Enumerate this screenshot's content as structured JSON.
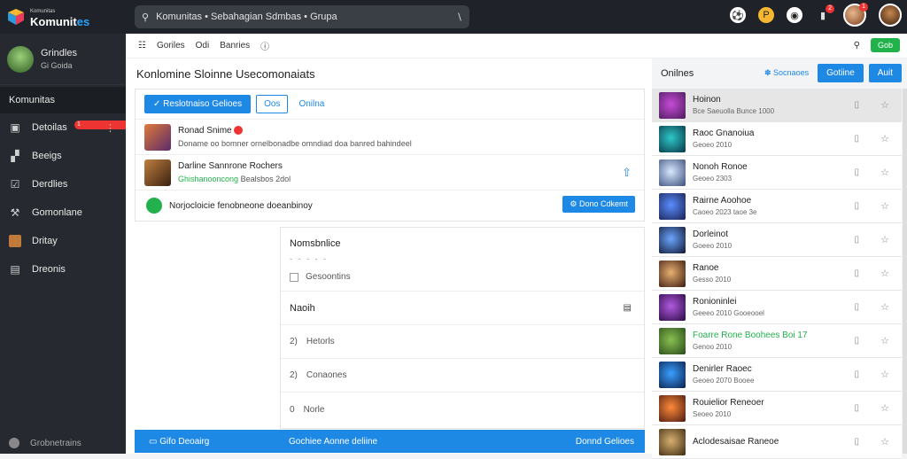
{
  "app": {
    "title": "Komunit",
    "title_accent": "es",
    "subtitle": "Komunitas"
  },
  "search": {
    "text": "Komunitas • Sebahagian Sdmbas • Grupa"
  },
  "top": {
    "notif_count": "2",
    "avatar_badge": "1"
  },
  "profile": {
    "name": "Grindles",
    "sub": "Gi Goida"
  },
  "sidebar": {
    "title": "Komunitas",
    "items": [
      {
        "label": "Detoilas",
        "icon": "camera-icon",
        "badge": "1"
      },
      {
        "label": "Beeigs",
        "icon": "layout-icon"
      },
      {
        "label": "Derdlies",
        "icon": "check-icon"
      },
      {
        "label": "Gomonlane",
        "icon": "hammer-icon"
      },
      {
        "label": "Dritay",
        "icon": "character-icon"
      },
      {
        "label": "Dreonis",
        "icon": "document-icon"
      }
    ],
    "footer": "Grobnetrains"
  },
  "subbar": {
    "items": [
      "Goriles",
      "Odi",
      "Banries"
    ],
    "new_label": "Gob"
  },
  "main": {
    "heading": "Konlomine Sloinne Usecomonaiats",
    "feed_button": "Reslotnaiso Gelioes",
    "feed_tab": "Oos",
    "feed_link": "Onilna",
    "posts": [
      {
        "title": "Ronad Snime",
        "sub": "Doname oo bomner ornelbonadbe omndiad doa banred bahindeel"
      },
      {
        "title": "Darline Sannrone Rochers",
        "sub_green": "Ghishanooncong",
        "sub": "Bealsbos 2dol"
      }
    ],
    "notice": {
      "text": "Norjocloicie fenobneone doeanbinoy",
      "button": "Dono Cdkemt"
    }
  },
  "panel": {
    "title": "Nomsbnlice",
    "checkbox": "Gesoontins",
    "section": "Naoih",
    "rows": [
      {
        "label": "Hetorls",
        "num": "2)"
      },
      {
        "label": "Conaones",
        "num": "2)"
      },
      {
        "label": "Norle",
        "num": "0"
      }
    ]
  },
  "bottom": {
    "left": "Gifo Deoairg",
    "mid": "Gochiee  Aonne deliine",
    "right": "Donnd Gelioes"
  },
  "right": {
    "title": "Onilnes",
    "link": "Socnaoes",
    "btn1": "Gotiine",
    "btn2": "Auit",
    "items": [
      {
        "title": "Hoinon",
        "sub": "Bce Saeuolla  Bunce 1000",
        "sel": true,
        "c1": "#c64bd6",
        "c2": "#4a1c5a"
      },
      {
        "title": "Raoc Gnanoiua",
        "sub": "Geoeo 2010",
        "c1": "#2cc8c8",
        "c2": "#0a3545"
      },
      {
        "title": "Nonoh Ronoe",
        "sub": "Geoeo 2303",
        "c1": "#d8e8ff",
        "c2": "#3a4d7a"
      },
      {
        "title": "Rairne Aoohoe",
        "sub": "Caoeo 2023  taoe  3e",
        "c1": "#5a8dff",
        "c2": "#1a2050"
      },
      {
        "title": "Dorleinot",
        "sub": "Goeeo 2010",
        "c1": "#6ba6ff",
        "c2": "#101630"
      },
      {
        "title": "Ranoe",
        "sub": "Gesso 2010",
        "c1": "#e8b070",
        "c2": "#3a1a10"
      },
      {
        "title": "Ronioninlei",
        "sub": "Geeeo 2010  Gooeooel",
        "c1": "#b05ae0",
        "c2": "#2a0a40"
      },
      {
        "title": "Foarre Rone Boohees Boi 17",
        "sub": "Genoo 2010",
        "green": true,
        "c1": "#88c050",
        "c2": "#2a4a1a"
      },
      {
        "title": "Denirler Raoec",
        "sub": "Geoeo 2070  Booee",
        "c1": "#3aa0ff",
        "c2": "#0a1f4a"
      },
      {
        "title": "Rouielior Reneoer",
        "sub": "Seoeo 2010",
        "c1": "#ff8a3a",
        "c2": "#4a1a10"
      },
      {
        "title": "Aclodesaisae Raneoe",
        "sub": "",
        "c1": "#d8b070",
        "c2": "#3a2a10"
      }
    ]
  }
}
